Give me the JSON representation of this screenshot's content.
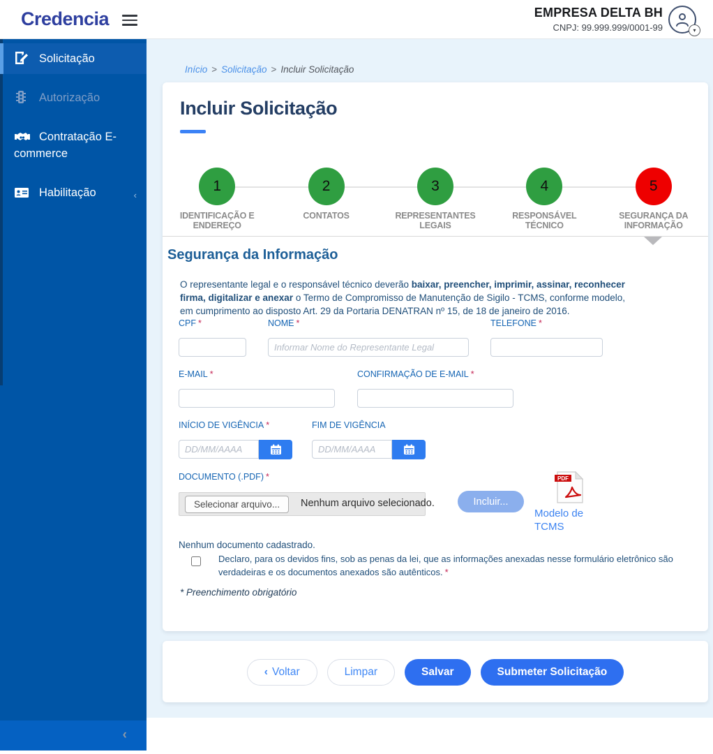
{
  "header": {
    "logo": "Credencia",
    "company_name": "EMPRESA DELTA BH",
    "company_cnpj": "CNPJ: 99.999.999/0001-99",
    "avatar_chevron": "▾"
  },
  "sidebar": {
    "items": [
      {
        "label": "Solicitação",
        "state": "active"
      },
      {
        "label": "Autorização",
        "state": "disabled"
      },
      {
        "label": "Contratação E-commerce",
        "state": "normal"
      },
      {
        "label": "Habilitação",
        "state": "normal",
        "caret": "‹"
      }
    ],
    "collapse_chevron": "‹"
  },
  "breadcrumb": {
    "home": "Início",
    "separator": ">",
    "section": "Solicitação",
    "current": "Incluir Solicitação"
  },
  "page": {
    "title": "Incluir Solicitação"
  },
  "wizard": {
    "steps": [
      {
        "number": "1",
        "label": "IDENTIFICAÇÃO E ENDEREÇO",
        "status": "done"
      },
      {
        "number": "2",
        "label": "CONTATOS",
        "status": "done"
      },
      {
        "number": "3",
        "label": "REPRESENTANTES LEGAIS",
        "status": "done"
      },
      {
        "number": "4",
        "label": "RESPONSÁVEL TÉCNICO",
        "status": "done"
      },
      {
        "number": "5",
        "label": "SEGURANÇA DA INFORMAÇÃO",
        "status": "current"
      }
    ]
  },
  "form": {
    "heading": "Segurança da Informação",
    "intro_1": "O representante legal e o responsável técnico deverão ",
    "intro_bold": "baixar, preencher, imprimir, assinar, reconhecer firma, digitalizar e anexar",
    "intro_2": " o Termo de Compromisso de Manutenção de Sigilo - TCMS, conforme modelo, em cumprimento ao disposto Art. 29 da Portaria DENATRAN nº 15, de 18 de janeiro de 2016.",
    "fields": {
      "cpf": {
        "label": "CPF",
        "required": "*",
        "value": "",
        "placeholder": ""
      },
      "nome": {
        "label": "NOME",
        "required": "*",
        "value": "",
        "placeholder": "Informar Nome do Representante Legal"
      },
      "telefone": {
        "label": "TELEFONE",
        "required": "*",
        "value": "",
        "placeholder": ""
      },
      "email": {
        "label": "E-MAIL",
        "required": "*",
        "value": "",
        "placeholder": ""
      },
      "email_conf": {
        "label": "CONFIRMAÇÃO DE E-MAIL",
        "required": "*",
        "value": "",
        "placeholder": ""
      },
      "inicio_vigencia": {
        "label": "INÍCIO DE VIGÊNCIA",
        "required": "*",
        "value": "",
        "placeholder": "DD/MM/AAAA"
      },
      "fim_vigencia": {
        "label": "FIM DE VIGÊNCIA",
        "value": "",
        "placeholder": "DD/MM/AAAA"
      }
    },
    "documento": {
      "label": "DOCUMENTO (.PDF)",
      "required": "*",
      "file_button": "Selecionar arquivo...",
      "file_status": "Nenhum arquivo selecionado.",
      "incluir_button": "Incluir...",
      "pdf_badge": "PDF",
      "modelo_link": "Modelo de TCMS"
    },
    "no_document": "Nenhum documento cadastrado.",
    "declaration": "Declaro, para os devidos fins, sob as penas da lei, que as informações anexadas nesse formulário eletrônico são verdadeiras e os documentos anexados são autênticos.",
    "declaration_required": "*",
    "declaration_checked": false,
    "required_note": "* Preenchimento obrigatório"
  },
  "actions": {
    "voltar_chevron": "‹",
    "voltar": "Voltar",
    "limpar": "Limpar",
    "salvar": "Salvar",
    "submeter": "Submeter Solicitação"
  },
  "colors": {
    "sidebar_blue": "#0055a6",
    "sidebar_footer_blue": "#0561c2",
    "accent_blue": "#2e6ff0",
    "step_done_green": "#2f9e41",
    "step_current_red": "#ee0000",
    "label_blue": "#1464b3",
    "link_blue": "#3c83f1",
    "content_bg": "#e8f3fb",
    "required_red": "#c42655"
  }
}
